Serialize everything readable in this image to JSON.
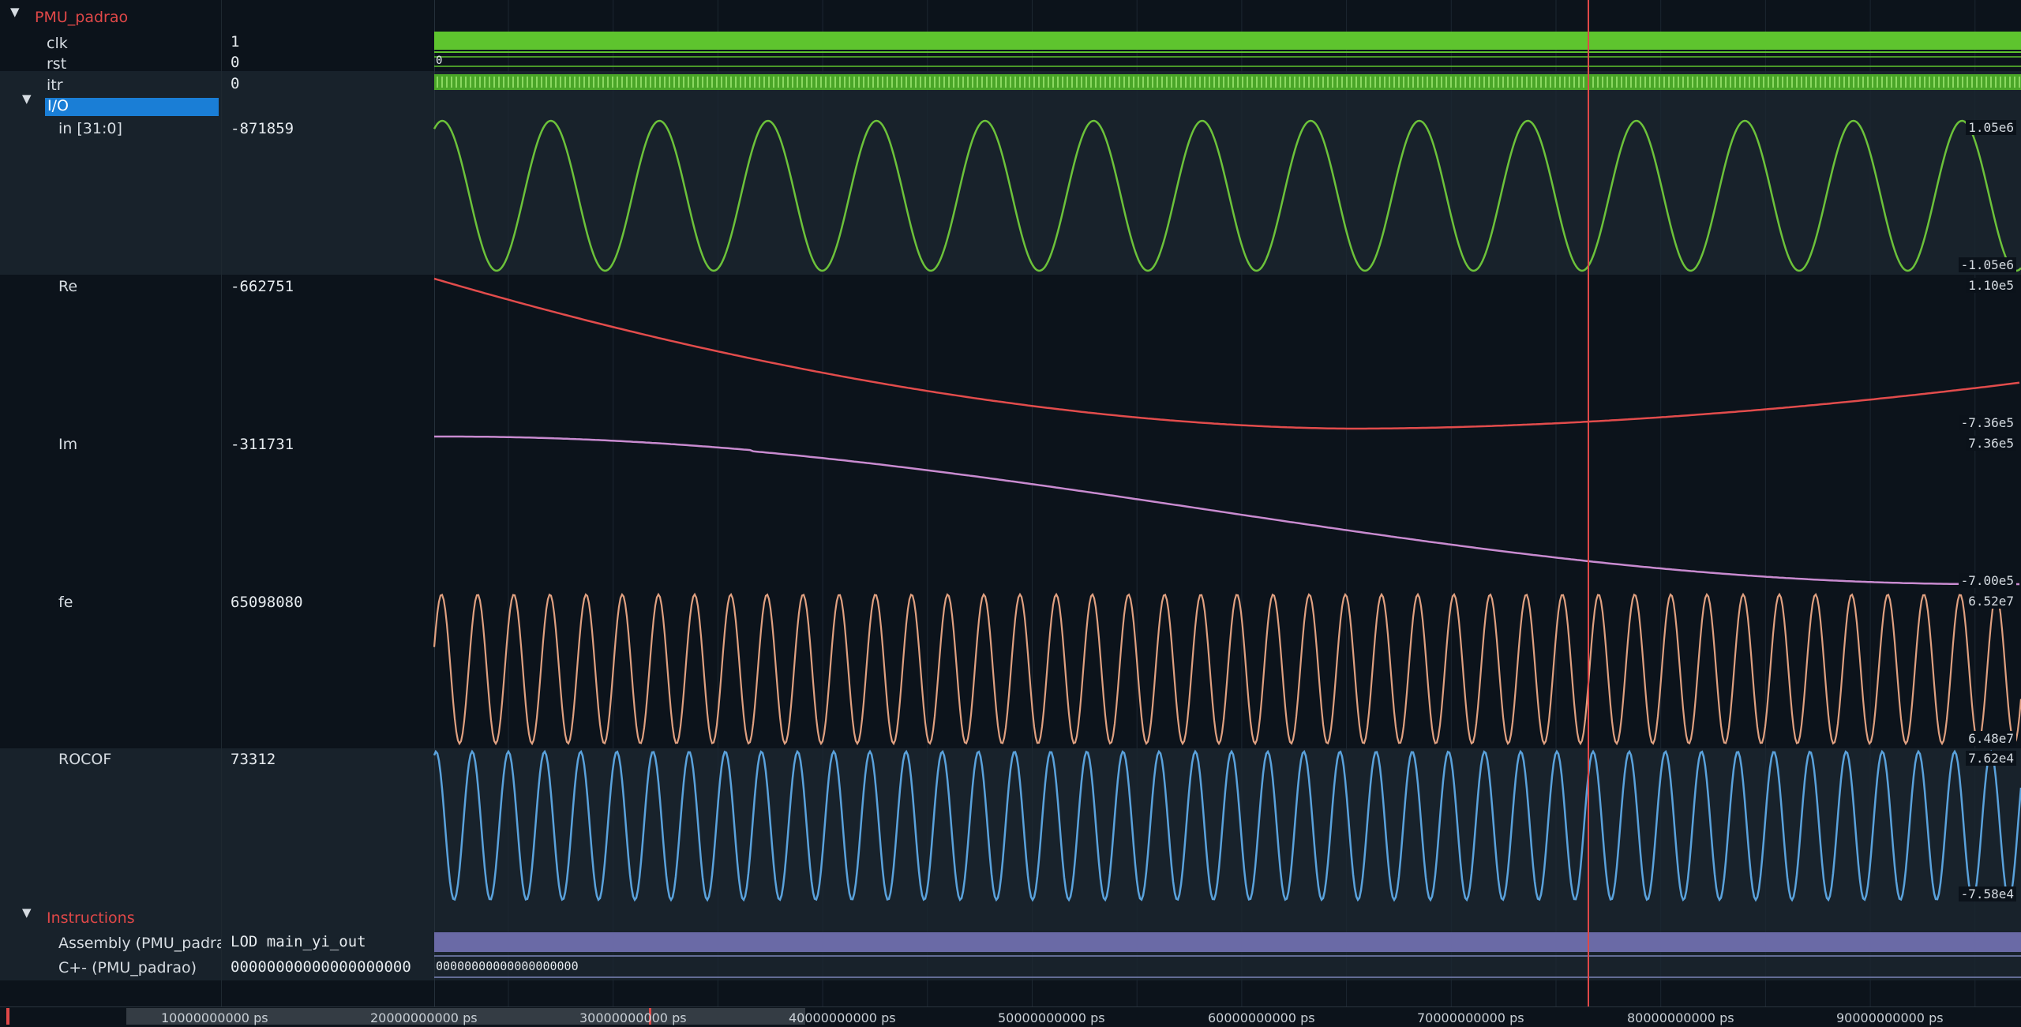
{
  "scope": {
    "name": "PMU_padrao"
  },
  "signals": {
    "clk": {
      "name": "clk",
      "value": "1"
    },
    "rst": {
      "name": "rst",
      "value": "0",
      "wave_text": "0"
    },
    "itr": {
      "name": "itr",
      "value": "0"
    },
    "io": {
      "name": "I/O"
    },
    "in": {
      "name": "in [31:0]",
      "value": "-871859",
      "scale_max": "1.05e6",
      "scale_min": "-1.05e6"
    },
    "re": {
      "name": "Re",
      "value": "-662751",
      "scale_max": "1.10e5",
      "scale_min": "-7.36e5"
    },
    "im": {
      "name": "Im",
      "value": "-311731",
      "scale_max": "7.36e5",
      "scale_min": "-7.00e5"
    },
    "fe": {
      "name": "fe",
      "value": "65098080",
      "scale_max": "6.52e7",
      "scale_min": "6.48e7"
    },
    "rocof": {
      "name": "ROCOF",
      "value": "73312",
      "scale_max": "7.62e4",
      "scale_min": "-7.58e4"
    }
  },
  "instructions": {
    "name": "Instructions",
    "assembly": {
      "name": "Assembly (PMU_padrao)",
      "value": "LOD main_yi_out"
    },
    "cplus": {
      "name": "C+- (PMU_padrao)",
      "value": "00000000000000000000",
      "wave_text": "00000000000000000000"
    }
  },
  "timeline": {
    "ticks": [
      "10000000000 ps",
      "20000000000 ps",
      "30000000000 ps",
      "40000000000 ps",
      "50000000000 ps",
      "60000000000 ps",
      "70000000000 ps",
      "80000000000 ps",
      "90000000000 ps"
    ]
  },
  "colors": {
    "clk": "#5ec42e",
    "in": "#6cc23a",
    "re": "#e24c4c",
    "im": "#c98bd0",
    "fe": "#e0a080",
    "rocof": "#5aa2dc",
    "cursor": "#e04848",
    "assembly": "#6a6aa6",
    "selection": "#1a7ed6"
  }
}
